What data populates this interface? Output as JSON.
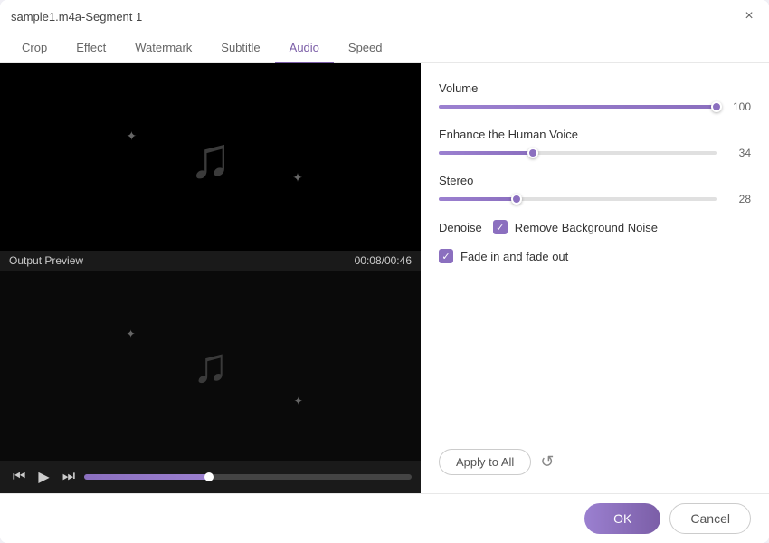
{
  "window": {
    "title": "sample1.m4a-Segment 1",
    "close_label": "×"
  },
  "tabs": [
    {
      "label": "Crop",
      "active": false
    },
    {
      "label": "Effect",
      "active": false
    },
    {
      "label": "Watermark",
      "active": false
    },
    {
      "label": "Subtitle",
      "active": false
    },
    {
      "label": "Audio",
      "active": true
    },
    {
      "label": "Speed",
      "active": false
    }
  ],
  "output_preview": {
    "label": "Output Preview",
    "timestamp": "00:08/00:46"
  },
  "audio_controls": {
    "volume": {
      "label": "Volume",
      "value": 100,
      "percent": 100
    },
    "enhance_voice": {
      "label": "Enhance the Human Voice",
      "value": 34,
      "percent": 34
    },
    "stereo": {
      "label": "Stereo",
      "value": 28,
      "percent": 28
    },
    "denoise": {
      "label": "Denoise",
      "remove_bg_noise_label": "Remove Background Noise",
      "checked": true
    },
    "fade": {
      "label": "Fade in and fade out",
      "checked": true
    }
  },
  "actions": {
    "apply_to_all": "Apply to All",
    "reset_icon": "↺",
    "ok": "OK",
    "cancel": "Cancel"
  },
  "icons": {
    "music_note": "♫",
    "sparkle": "✦",
    "prev": "⏮",
    "play": "▶",
    "next": "⏭",
    "checkmark": "✓"
  }
}
